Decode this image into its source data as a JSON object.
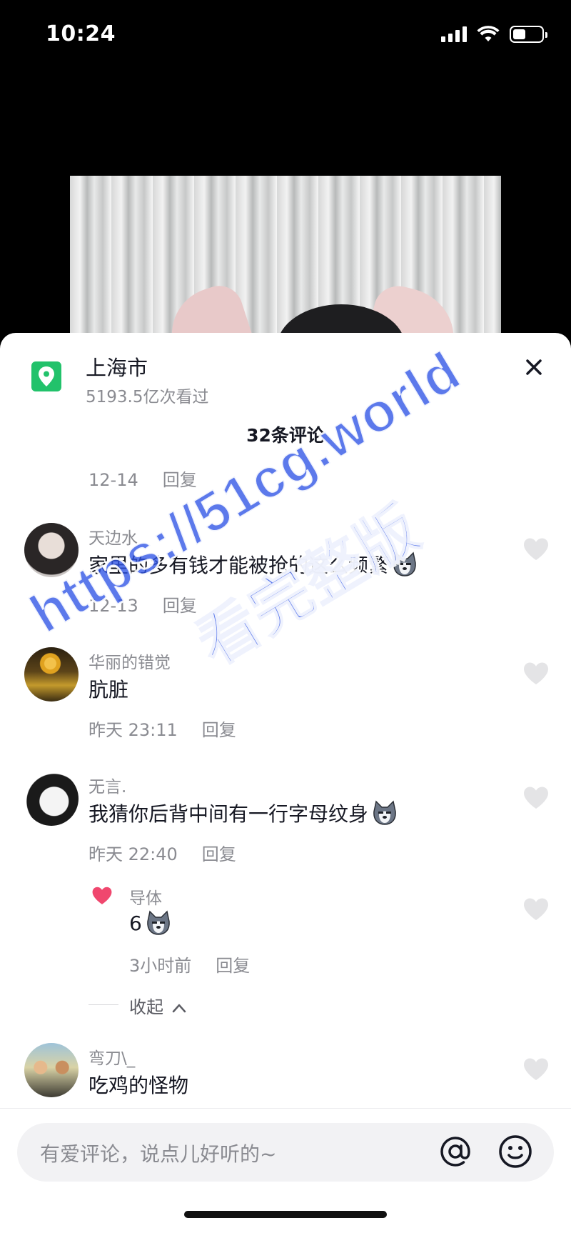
{
  "status_bar": {
    "time": "10:24",
    "battery_level": 0.45
  },
  "location": {
    "name": "上海市",
    "views": "5193.5亿次看过"
  },
  "comments_header": {
    "count_label": "32条评论"
  },
  "top_partial": {
    "date": "12-14",
    "reply": "回复"
  },
  "comments": [
    {
      "username": "天边水",
      "text": "家里的多有钱才能被抢的这么频繁",
      "emoji": "husky-emoji",
      "date": "12-13",
      "reply": "回复"
    },
    {
      "username": "华丽的错觉",
      "text": "肮脏",
      "date": "昨天 23:11",
      "reply": "回复"
    },
    {
      "username": "无言.",
      "text": "我猜你后背中间有一行字母纹身",
      "emoji": "husky-emoji",
      "date": "昨天 22:40",
      "reply": "回复",
      "sub_reply": {
        "username": "导体",
        "text": "6",
        "emoji": "husky-emoji",
        "date": "3小时前",
        "reply": "回复"
      }
    },
    {
      "username": "弯刀\\_",
      "text": "吃鸡的怪物"
    }
  ],
  "collapse_label": "收起",
  "input": {
    "placeholder": "有爱评论，说点儿好听的~"
  },
  "watermark": {
    "line1": "https://51cg.world",
    "line2": "看完整版"
  },
  "colors": {
    "accent_green": "#22c26b",
    "watermark_blue": "#2e53e6",
    "like_pink": "#fe2c55"
  }
}
